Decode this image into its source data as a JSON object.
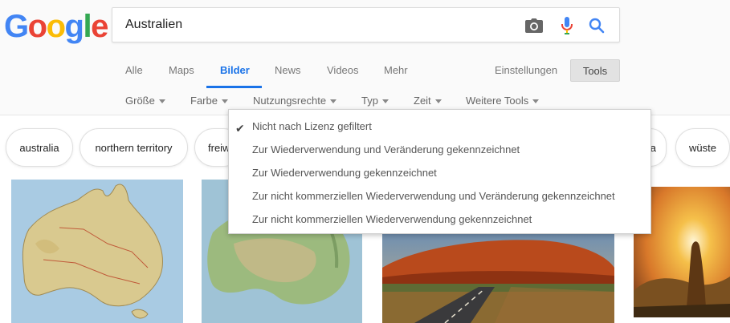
{
  "logo": {
    "letters": [
      "G",
      "o",
      "o",
      "g",
      "l",
      "e"
    ]
  },
  "search": {
    "query": "Australien",
    "icons": [
      "camera-icon",
      "microphone-icon",
      "search-icon"
    ]
  },
  "tabs": [
    {
      "label": "Alle"
    },
    {
      "label": "Maps"
    },
    {
      "label": "Bilder"
    },
    {
      "label": "News"
    },
    {
      "label": "Videos"
    },
    {
      "label": "Mehr"
    }
  ],
  "active_tab": "Bilder",
  "settings_label": "Einstellungen",
  "tools_label": "Tools",
  "filters": [
    {
      "label": "Größe"
    },
    {
      "label": "Farbe"
    },
    {
      "label": "Nutzungsrechte"
    },
    {
      "label": "Typ"
    },
    {
      "label": "Zeit"
    },
    {
      "label": "Weitere Tools"
    }
  ],
  "chips": [
    {
      "label": "australia"
    },
    {
      "label": "northern territory"
    },
    {
      "label": "freiw"
    },
    {
      "label": "a"
    },
    {
      "label": "wüste"
    }
  ],
  "usage_rights_menu": {
    "selected_index": 0,
    "items": [
      {
        "label": "Nicht nach Lizenz gefiltert"
      },
      {
        "label": "Zur Wiederverwendung und Veränderung gekennzeichnet"
      },
      {
        "label": "Zur Wiederverwendung gekennzeichnet"
      },
      {
        "label": "Zur nicht kommerziellen Wiederverwendung und Veränderung gekennzeichnet"
      },
      {
        "label": "Zur nicht kommerziellen Wiederverwendung gekennzeichnet"
      }
    ]
  },
  "colors": {
    "accent": "#1a73e8",
    "header_bg": "#fafafa",
    "tools_bg": "#e2e2e2"
  }
}
